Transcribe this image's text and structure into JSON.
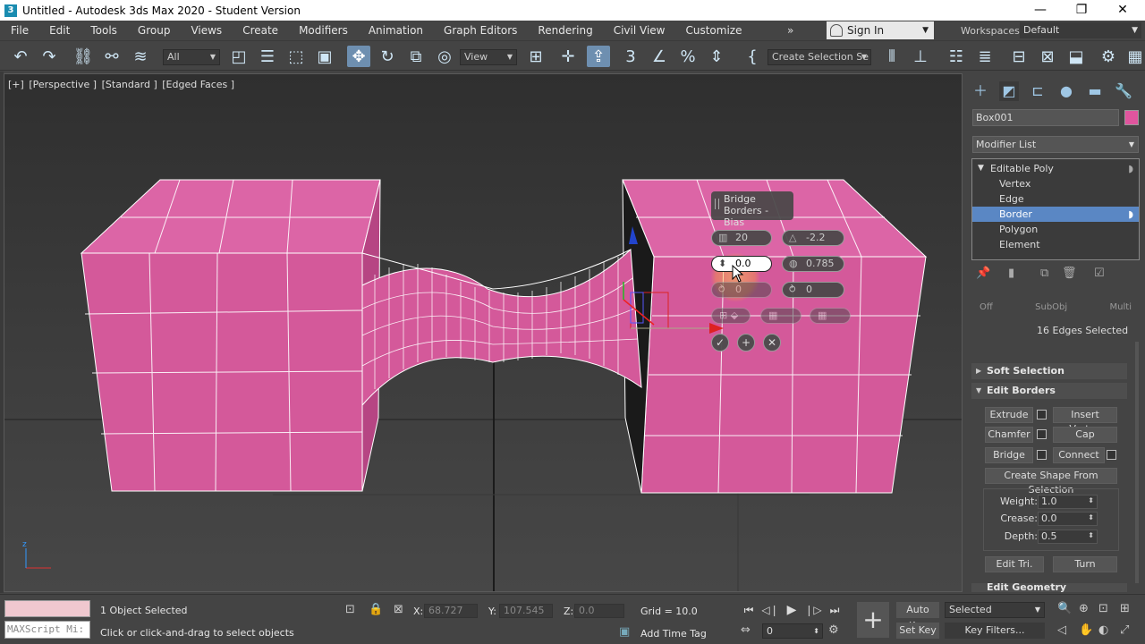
{
  "titlebar": {
    "title": "Untitled - Autodesk 3ds Max 2020 - Student Version",
    "minimize": "—",
    "maximize": "❐",
    "close": "✕"
  },
  "menu": [
    "File",
    "Edit",
    "Tools",
    "Group",
    "Views",
    "Create",
    "Modifiers",
    "Animation",
    "Graph Editors",
    "Rendering",
    "Civil View",
    "Customize"
  ],
  "menu_more": "»",
  "account": {
    "sign_in": "Sign In",
    "workspaces_label": "Workspaces:",
    "workspace": "Default"
  },
  "toolbar": {
    "filter": "All",
    "ref_coord": "View",
    "selection_set": "Create Selection Se"
  },
  "viewport": {
    "labels": [
      "[+]",
      "[Perspective ]",
      "[Standard ]",
      "[Edged Faces ]"
    ]
  },
  "caddy": {
    "title": "Bridge Borders - Bias",
    "segments": "20",
    "taper": "-2.2",
    "bias": "0.0",
    "smooth": "0.785",
    "twist1": "0",
    "twist2": "0"
  },
  "command_panel": {
    "object_name": "Box001",
    "object_color": "#e0559e",
    "modifier_list": "Modifier List",
    "stack": [
      "Editable Poly",
      "Vertex",
      "Edge",
      "Border",
      "Polygon",
      "Element"
    ],
    "stack_selected": "Border",
    "hidden_row": [
      "Off",
      "SubObj",
      "Multi"
    ],
    "edges_selected": "16 Edges Selected",
    "soft_selection": "Soft Selection",
    "edit_borders": "Edit Borders",
    "buttons": {
      "extrude": "Extrude",
      "insert_vertex": "Insert Vertex",
      "chamfer": "Chamfer",
      "cap": "Cap",
      "bridge": "Bridge",
      "connect": "Connect",
      "create_shape": "Create Shape From Selection",
      "edit_tri": "Edit Tri.",
      "turn": "Turn"
    },
    "weight_label": "Weight:",
    "weight": "1.0",
    "crease_label": "Crease:",
    "crease": "0.0",
    "depth_label": "Depth:",
    "depth": "0.5",
    "edit_geometry": "Edit Geometry"
  },
  "status": {
    "listener": "MAXScript Mi:",
    "objects_selected": "1 Object Selected",
    "prompt": "Click or click-and-drag to select objects",
    "x_label": "X:",
    "x": "68.727",
    "y_label": "Y:",
    "y": "107.545",
    "z_label": "Z:",
    "z": "0.0",
    "grid": "Grid = 10.0",
    "add_time_tag": "Add Time Tag",
    "auto_key": "Auto Key",
    "set_key": "Set Key",
    "key_mode": "Selected",
    "key_filters": "Key Filters...",
    "frame": "0"
  },
  "colors": {
    "mesh": "#d4599a",
    "selection_blue": "#5a87c4"
  }
}
